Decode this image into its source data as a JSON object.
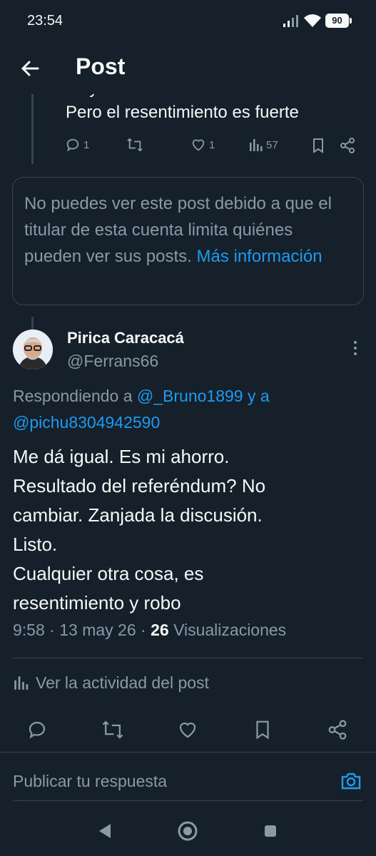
{
  "status_bar": {
    "time": "23:54",
    "battery": "90"
  },
  "header": {
    "title": "Post"
  },
  "previous_post": {
    "text_cut": "mayor discusión.",
    "text_line": "Pero el resentimiento es fuerte",
    "replies": "1",
    "likes": "1",
    "views": "57"
  },
  "notice": {
    "text": "No puedes ver este post debido a que el titular de esta cuenta limita quiénes pueden ver sus posts.",
    "link": "Más información"
  },
  "post": {
    "author_name": "Pirica Caracacá",
    "author_handle": "@Ferrans66",
    "replying_prefix": "Respondiendo a",
    "mention_1": "@_Bruno1899",
    "replying_connector": "y a",
    "mention_2": "@pichu8304942590",
    "body_lines": [
      "Me dá igual. Es mi ahorro.",
      "Resultado del referéndum? No",
      "cambiar. Zanjada la discusión.",
      "Listo.",
      "Cualquier otra cosa, es",
      "resentimiento y robo"
    ],
    "time": "9:58",
    "date": "13 may 26",
    "views_count": "26",
    "views_label": "Visualizaciones",
    "activity_label": "Ver la actividad del post"
  },
  "reply_bar": {
    "placeholder": "Publicar tu respuesta"
  },
  "colors": {
    "background": "#15202b",
    "accent": "#1d9bf0",
    "muted": "#8b98a5",
    "border": "#38444d"
  }
}
